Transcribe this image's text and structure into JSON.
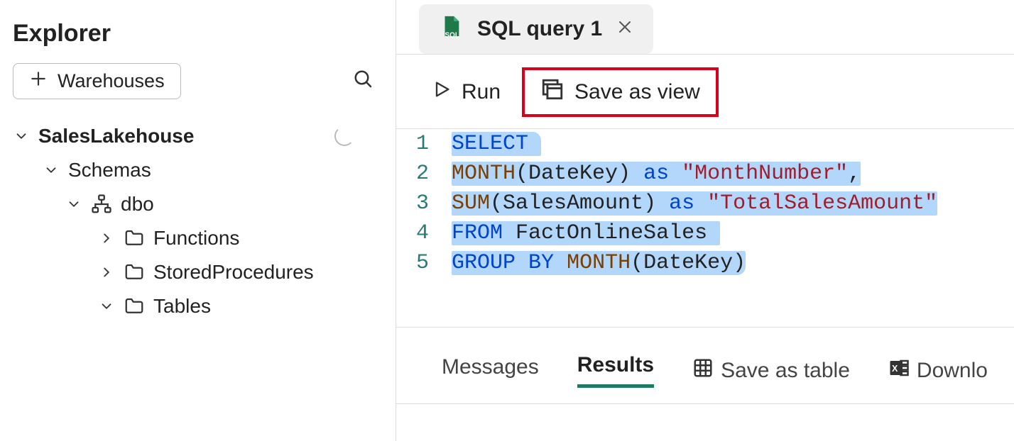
{
  "sidebar": {
    "title": "Explorer",
    "warehouses_label": "Warehouses",
    "tree": {
      "db": "SalesLakehouse",
      "schemas_label": "Schemas",
      "schema": "dbo",
      "functions": "Functions",
      "storedprocs": "StoredProcedures",
      "tables": "Tables"
    }
  },
  "tab": {
    "label": "SQL query 1"
  },
  "toolbar": {
    "run": "Run",
    "save_as_view": "Save as view"
  },
  "editor": {
    "lines": {
      "l1_num": "1",
      "l2_num": "2",
      "l3_num": "3",
      "l4_num": "4",
      "l5_num": "5",
      "l1": {
        "kw": "SELECT"
      },
      "l2": {
        "fn": "MONTH",
        "open": "(",
        "arg": "DateKey",
        "close": ") ",
        "as": "as ",
        "str": "\"MonthNumber\"",
        "comma": ","
      },
      "l3": {
        "fn": "SUM",
        "open": "(",
        "arg": "SalesAmount",
        "close": ") ",
        "as": "as ",
        "str": "\"TotalSalesAmount\""
      },
      "l4": {
        "from": "FROM",
        "sp": " ",
        "tbl": "FactOnlineSales"
      },
      "l5": {
        "gb1": "GROUP",
        "sp1": " ",
        "gb2": "BY",
        "sp2": " ",
        "fn": "MONTH",
        "open": "(",
        "arg": "DateKey",
        "close": ")"
      }
    }
  },
  "results": {
    "messages": "Messages",
    "results": "Results",
    "save_as_table": "Save as table",
    "download": "Downlo"
  }
}
